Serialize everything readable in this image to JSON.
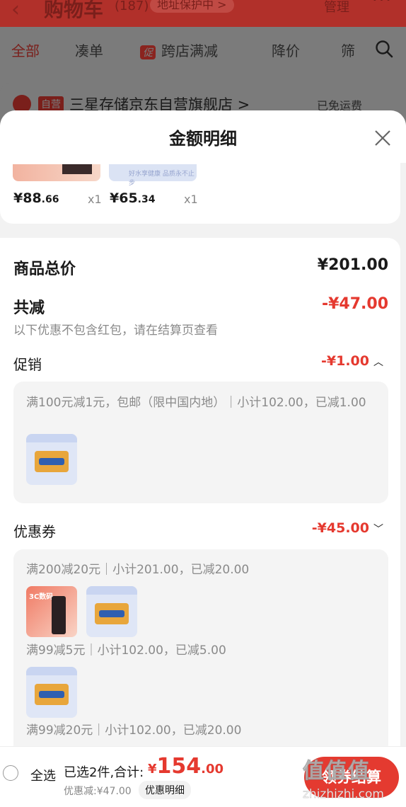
{
  "background": {
    "header": {
      "back_icon": "chevron-left-icon",
      "title": "购物车",
      "count": "(187)",
      "address": "地址保护中 >",
      "manage": "管理",
      "more": "···"
    },
    "tabs": [
      "全部",
      "凑单",
      "跨店满减",
      "降价",
      "筛"
    ],
    "promo_badge": "促",
    "store": {
      "badge": "自营",
      "name": "三星存储京东自营旗舰店 >",
      "shipping": "已免运费"
    }
  },
  "sheet": {
    "title": "金额明细",
    "products": [
      {
        "price_int": "¥88",
        "price_dec": ".66",
        "qty": "x1"
      },
      {
        "price_int": "¥65",
        "price_dec": ".34",
        "qty": "x1"
      }
    ],
    "product_caption": "好水享健康 品质永不止步",
    "total_label": "商品总价",
    "total_value": "¥201.00",
    "reduce_label": "共减",
    "reduce_value": "-¥47.00",
    "reduce_note": "以下优惠不包含红包，请在结算页查看",
    "promo": {
      "label": "促销",
      "value": "-¥1.00",
      "rule": "满100元减1元，包邮（限中国内地）｜小计102.00，已减1.00"
    },
    "coupon": {
      "label": "优惠券",
      "value": "-¥45.00",
      "rules": [
        "满200减20元｜小计201.00，已减20.00",
        "满99减5元｜小计102.00，已减5.00",
        "满99减20元｜小计102.00，已减20.00"
      ],
      "thumb_label": "3C数码"
    }
  },
  "bottom": {
    "select_all": "全选",
    "picked": "已选2件,合计:",
    "total_cur": "¥",
    "total_int": "154",
    "total_dec": ".00",
    "discount": "优惠减:¥47.00",
    "detail_link": "优惠明细",
    "checkout": "领券结算"
  },
  "watermark": {
    "logo": "值值值",
    "url": "zhizhizhi.com"
  },
  "colors": {
    "accent_red": "#e5392f",
    "checkout_red": "#e43a30"
  }
}
